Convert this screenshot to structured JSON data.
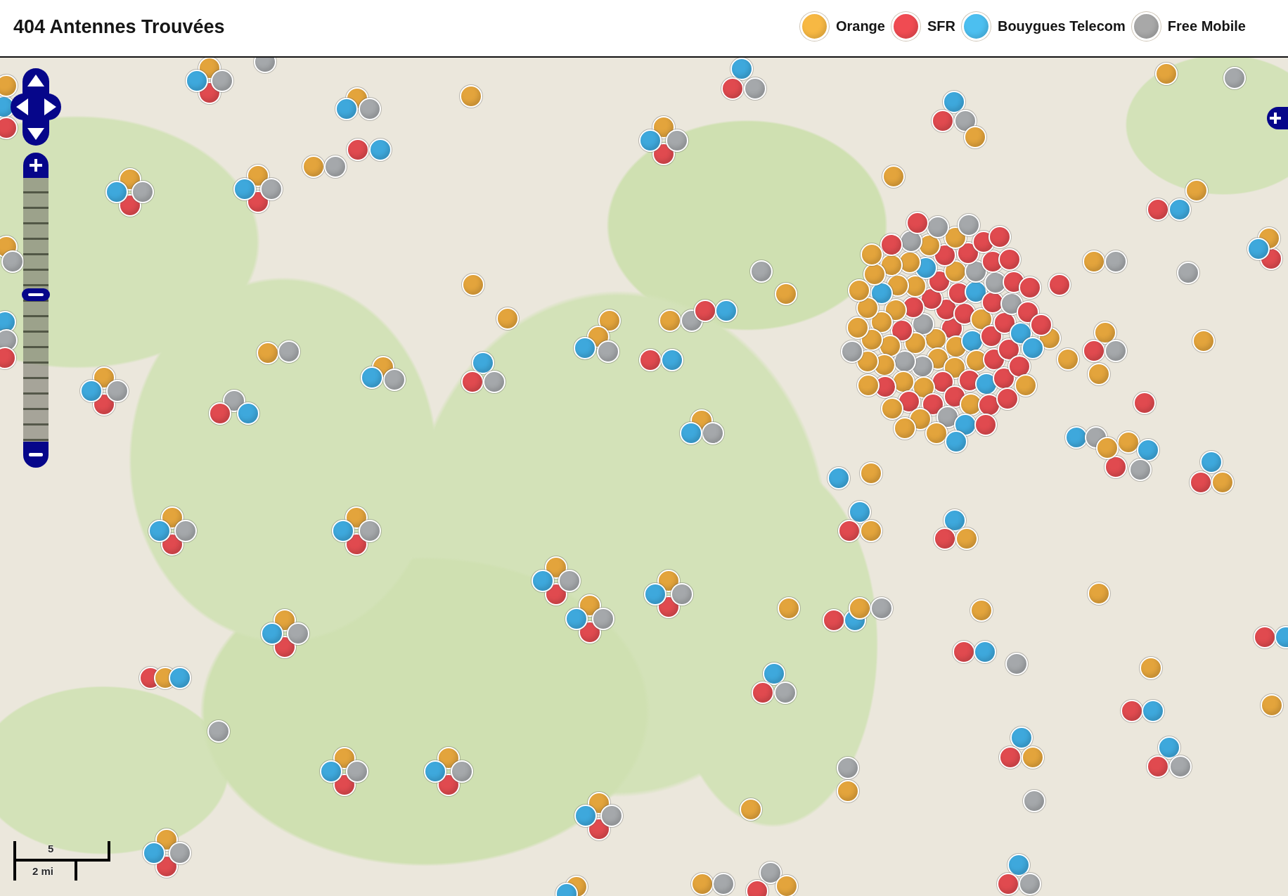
{
  "header": {
    "title": "404 Antennes Trouvées"
  },
  "legend": [
    {
      "label": "Orange",
      "color": "#f7b843"
    },
    {
      "label": "SFR",
      "color": "#f04b52"
    },
    {
      "label": "Bouygues Telecom",
      "color": "#4cbff0"
    },
    {
      "label": "Free Mobile",
      "color": "#a8a8a8"
    }
  ],
  "map": {
    "zoom": {
      "level": 0.56
    },
    "scale": {
      "top_label": "5",
      "bottom_label": "2 mi"
    },
    "markers": [
      {
        "color": "#e04a4f"
      },
      {
        "color": "#e3a43c"
      },
      {
        "color": "#a5a8ab"
      },
      {
        "color": "#3ea8dc"
      },
      {
        "color": "#a5a8ab"
      },
      {
        "color": "#e3a43c"
      },
      {
        "color": "#3ea8dc"
      },
      {
        "color": "#e3a43c"
      },
      {
        "color": "#e04a4f"
      },
      {
        "color": "#e3a43c"
      },
      {
        "color": "#a5a8ab"
      },
      {
        "color": "#3ea8dc"
      },
      {
        "color": "#e04a4f"
      },
      {
        "color": "#3ea8dc"
      },
      {
        "color": "#e3a43c"
      },
      {
        "color": "#a5a8ab"
      },
      {
        "color": "#e04a4f"
      },
      {
        "color": "#e3a43c"
      },
      {
        "color": "#a5a8ab"
      },
      {
        "color": "#3ea8dc"
      },
      {
        "color": "#e04a4f"
      },
      {
        "color": "#e3a43c"
      },
      {
        "color": "#a5a8ab"
      },
      {
        "color": "#3ea8dc"
      },
      {
        "color": "#e04a4f"
      },
      {
        "color": "#e3a43c"
      },
      {
        "color": "#a5a8ab"
      },
      {
        "color": "#3ea8dc"
      },
      {
        "color": "#3ea8dc"
      },
      {
        "color": "#e04a4f"
      },
      {
        "color": "#a5a8ab"
      },
      {
        "color": "#a5a8ab"
      },
      {
        "color": "#e3a43c"
      },
      {
        "color": "#3ea8dc"
      },
      {
        "color": "#e04a4f"
      },
      {
        "color": "#a5a8ab"
      },
      {
        "color": "#e3a43c"
      },
      {
        "color": "#e3a43c"
      },
      {
        "color": "#e3a43c"
      },
      {
        "color": "#e04a4f"
      },
      {
        "color": "#3ea8dc"
      },
      {
        "color": "#e04a4f"
      },
      {
        "color": "#e3a43c"
      },
      {
        "color": "#3ea8dc"
      },
      {
        "color": "#a5a8ab"
      },
      {
        "color": "#e3a43c"
      },
      {
        "color": "#a5a8ab"
      },
      {
        "color": "#e04a4f"
      },
      {
        "color": "#e3a43c"
      },
      {
        "color": "#a5a8ab"
      },
      {
        "color": "#e3a43c"
      },
      {
        "color": "#e3a43c"
      },
      {
        "color": "#a5a8ab"
      },
      {
        "color": "#e3a43c"
      },
      {
        "color": "#e3a43c"
      },
      {
        "color": "#e3a43c"
      },
      {
        "color": "#a5a8ab"
      },
      {
        "color": "#3ea8dc"
      },
      {
        "color": "#e3a43c"
      },
      {
        "color": "#a5a8ab"
      },
      {
        "color": "#e04a4f"
      },
      {
        "color": "#3ea8dc"
      },
      {
        "color": "#e04a4f"
      },
      {
        "color": "#3ea8dc"
      },
      {
        "color": "#3ea8dc"
      },
      {
        "color": "#a5a8ab"
      },
      {
        "color": "#e04a4f"
      },
      {
        "color": "#e3a43c"
      },
      {
        "color": "#a5a8ab"
      },
      {
        "color": "#e3a43c"
      },
      {
        "color": "#a5a8ab"
      },
      {
        "color": "#3ea8dc"
      },
      {
        "color": "#3ea8dc"
      },
      {
        "color": "#e04a4f"
      },
      {
        "color": "#a5a8ab"
      },
      {
        "color": "#e04a4f"
      },
      {
        "color": "#e3a43c"
      },
      {
        "color": "#a5a8ab"
      },
      {
        "color": "#3ea8dc"
      },
      {
        "color": "#a5a8ab"
      },
      {
        "color": "#e04a4f"
      },
      {
        "color": "#3ea8dc"
      },
      {
        "color": "#e3a43c"
      },
      {
        "color": "#e3a43c"
      },
      {
        "color": "#e3a43c"
      },
      {
        "color": "#e3a43c"
      },
      {
        "color": "#e04a4f"
      },
      {
        "color": "#a5a8ab"
      },
      {
        "color": "#e3a43c"
      },
      {
        "color": "#e04a4f"
      },
      {
        "color": "#e3a43c"
      },
      {
        "color": "#a5a8ab"
      },
      {
        "color": "#3ea8dc"
      },
      {
        "color": "#3ea8dc"
      },
      {
        "color": "#a5a8ab"
      },
      {
        "color": "#e3a43c"
      },
      {
        "color": "#3ea8dc"
      },
      {
        "color": "#e04a4f"
      },
      {
        "color": "#a5a8ab"
      },
      {
        "color": "#e3a43c"
      },
      {
        "color": "#3ea8dc"
      },
      {
        "color": "#e04a4f"
      },
      {
        "color": "#e3a43c"
      },
      {
        "color": "#e04a4f"
      },
      {
        "color": "#3ea8dc"
      },
      {
        "color": "#3ea8dc"
      },
      {
        "color": "#e3a43c"
      },
      {
        "color": "#3ea8dc"
      },
      {
        "color": "#e04a4f"
      },
      {
        "color": "#e3a43c"
      },
      {
        "color": "#3ea8dc"
      },
      {
        "color": "#e04a4f"
      },
      {
        "color": "#e3a43c"
      },
      {
        "color": "#e3a43c"
      },
      {
        "color": "#e3a43c"
      },
      {
        "color": "#e04a4f"
      },
      {
        "color": "#e3a43c"
      },
      {
        "color": "#a5a8ab"
      },
      {
        "color": "#3ea8dc"
      },
      {
        "color": "#e04a4f"
      },
      {
        "color": "#e3a43c"
      },
      {
        "color": "#a5a8ab"
      },
      {
        "color": "#3ea8dc"
      },
      {
        "color": "#e04a4f"
      },
      {
        "color": "#e3a43c"
      },
      {
        "color": "#a5a8ab"
      },
      {
        "color": "#3ea8dc"
      },
      {
        "color": "#e04a4f"
      },
      {
        "color": "#e3a43c"
      },
      {
        "color": "#a5a8ab"
      },
      {
        "color": "#3ea8dc"
      },
      {
        "color": "#e04a4f"
      },
      {
        "color": "#e3a43c"
      },
      {
        "color": "#a5a8ab"
      },
      {
        "color": "#3ea8dc"
      },
      {
        "color": "#e3a43c"
      },
      {
        "color": "#e04a4f"
      },
      {
        "color": "#3ea8dc"
      },
      {
        "color": "#e3a43c"
      },
      {
        "color": "#a5a8ab"
      },
      {
        "color": "#e04a4f"
      },
      {
        "color": "#e3a43c"
      },
      {
        "color": "#a5a8ab"
      },
      {
        "color": "#3ea8dc"
      },
      {
        "color": "#e04a4f"
      },
      {
        "color": "#e3a43c"
      },
      {
        "color": "#3ea8dc"
      },
      {
        "color": "#e04a4f"
      },
      {
        "color": "#3ea8dc"
      },
      {
        "color": "#a5a8ab"
      },
      {
        "color": "#e3a43c"
      },
      {
        "color": "#3ea8dc"
      },
      {
        "color": "#e04a4f"
      },
      {
        "color": "#a5a8ab"
      },
      {
        "color": "#e04a4f"
      },
      {
        "color": "#3ea8dc"
      },
      {
        "color": "#e3a43c"
      },
      {
        "color": "#a5a8ab"
      },
      {
        "color": "#3ea8dc"
      },
      {
        "color": "#e04a4f"
      },
      {
        "color": "#e3a43c"
      },
      {
        "color": "#3ea8dc"
      },
      {
        "color": "#e04a4f"
      },
      {
        "color": "#a5a8ab"
      },
      {
        "color": "#a5a8ab"
      },
      {
        "color": "#a5a8ab"
      },
      {
        "color": "#e3a43c"
      },
      {
        "color": "#e04a4f"
      },
      {
        "color": "#e3a43c"
      },
      {
        "color": "#a5a8ab"
      },
      {
        "color": "#3ea8dc"
      },
      {
        "color": "#e04a4f"
      },
      {
        "color": "#e3a43c"
      },
      {
        "color": "#a5a8ab"
      },
      {
        "color": "#3ea8dc"
      },
      {
        "color": "#e3a43c"
      },
      {
        "color": "#e04a4f"
      },
      {
        "color": "#e3a43c"
      },
      {
        "color": "#a5a8ab"
      },
      {
        "color": "#3ea8dc"
      },
      {
        "color": "#e04a4f"
      },
      {
        "color": "#e3a43c"
      },
      {
        "color": "#a5a8ab"
      },
      {
        "color": "#3ea8dc"
      },
      {
        "color": "#3ea8dc"
      },
      {
        "color": "#e04a4f"
      },
      {
        "color": "#a5a8ab"
      },
      {
        "color": "#e3a43c"
      },
      {
        "color": "#a5a8ab"
      },
      {
        "color": "#a5a8ab"
      },
      {
        "color": "#e3a43c"
      },
      {
        "color": "#e04a4f"
      },
      {
        "color": "#e3a43c"
      },
      {
        "color": "#3ea8dc"
      },
      {
        "color": "#e04a4f"
      },
      {
        "color": "#e3a43c"
      },
      {
        "color": "#e04a4f"
      },
      {
        "color": "#e3a43c"
      },
      {
        "color": "#a5a8ab"
      },
      {
        "color": "#e04a4f"
      },
      {
        "color": "#e3a43c"
      },
      {
        "color": "#e04a4f"
      },
      {
        "color": "#3ea8dc"
      },
      {
        "color": "#e3a43c"
      },
      {
        "color": "#e04a4f"
      },
      {
        "color": "#e3a43c"
      },
      {
        "color": "#e04a4f"
      },
      {
        "color": "#e3a43c"
      },
      {
        "color": "#a5a8ab"
      },
      {
        "color": "#e04a4f"
      },
      {
        "color": "#e3a43c"
      },
      {
        "color": "#e04a4f"
      },
      {
        "color": "#3ea8dc"
      },
      {
        "color": "#e04a4f"
      },
      {
        "color": "#e3a43c"
      },
      {
        "color": "#e04a4f"
      },
      {
        "color": "#a5a8ab"
      },
      {
        "color": "#e3a43c"
      },
      {
        "color": "#e04a4f"
      },
      {
        "color": "#e3a43c"
      },
      {
        "color": "#e04a4f"
      },
      {
        "color": "#e3a43c"
      },
      {
        "color": "#3ea8dc"
      },
      {
        "color": "#e04a4f"
      },
      {
        "color": "#e3a43c"
      },
      {
        "color": "#a5a8ab"
      },
      {
        "color": "#e04a4f"
      },
      {
        "color": "#e3a43c"
      },
      {
        "color": "#e04a4f"
      },
      {
        "color": "#e3a43c"
      },
      {
        "color": "#e04a4f"
      },
      {
        "color": "#3ea8dc"
      },
      {
        "color": "#e3a43c"
      },
      {
        "color": "#a5a8ab"
      },
      {
        "color": "#e04a4f"
      },
      {
        "color": "#e3a43c"
      },
      {
        "color": "#e04a4f"
      },
      {
        "color": "#e3a43c"
      },
      {
        "color": "#e04a4f"
      },
      {
        "color": "#e3a43c"
      },
      {
        "color": "#3ea8dc"
      },
      {
        "color": "#a5a8ab"
      },
      {
        "color": "#e04a4f"
      },
      {
        "color": "#e3a43c"
      },
      {
        "color": "#e04a4f"
      },
      {
        "color": "#e3a43c"
      },
      {
        "color": "#e04a4f"
      },
      {
        "color": "#a5a8ab"
      },
      {
        "color": "#e3a43c"
      },
      {
        "color": "#3ea8dc"
      },
      {
        "color": "#e04a4f"
      },
      {
        "color": "#e3a43c"
      },
      {
        "color": "#e04a4f"
      },
      {
        "color": "#e3a43c"
      },
      {
        "color": "#e04a4f"
      },
      {
        "color": "#e3a43c"
      },
      {
        "color": "#a5a8ab"
      },
      {
        "color": "#e04a4f"
      },
      {
        "color": "#e3a43c"
      },
      {
        "color": "#e04a4f"
      },
      {
        "color": "#3ea8dc"
      },
      {
        "color": "#e3a43c"
      },
      {
        "color": "#e04a4f"
      },
      {
        "color": "#e3a43c"
      },
      {
        "color": "#a5a8ab"
      },
      {
        "color": "#e04a4f"
      },
      {
        "color": "#e3a43c"
      },
      {
        "color": "#e04a4f"
      },
      {
        "color": "#e3a43c"
      },
      {
        "color": "#e04a4f"
      },
      {
        "color": "#3ea8dc"
      },
      {
        "color": "#e3a43c"
      },
      {
        "color": "#a5a8ab"
      },
      {
        "color": "#e04a4f"
      },
      {
        "color": "#e3a43c"
      },
      {
        "color": "#e04a4f"
      },
      {
        "color": "#e3a43c"
      },
      {
        "color": "#e04a4f"
      },
      {
        "color": "#e3a43c"
      },
      {
        "color": "#a5a8ab"
      },
      {
        "color": "#e04a4f"
      },
      {
        "color": "#3ea8dc"
      },
      {
        "color": "#e3a43c"
      },
      {
        "color": "#e04a4f"
      }
    ]
  }
}
